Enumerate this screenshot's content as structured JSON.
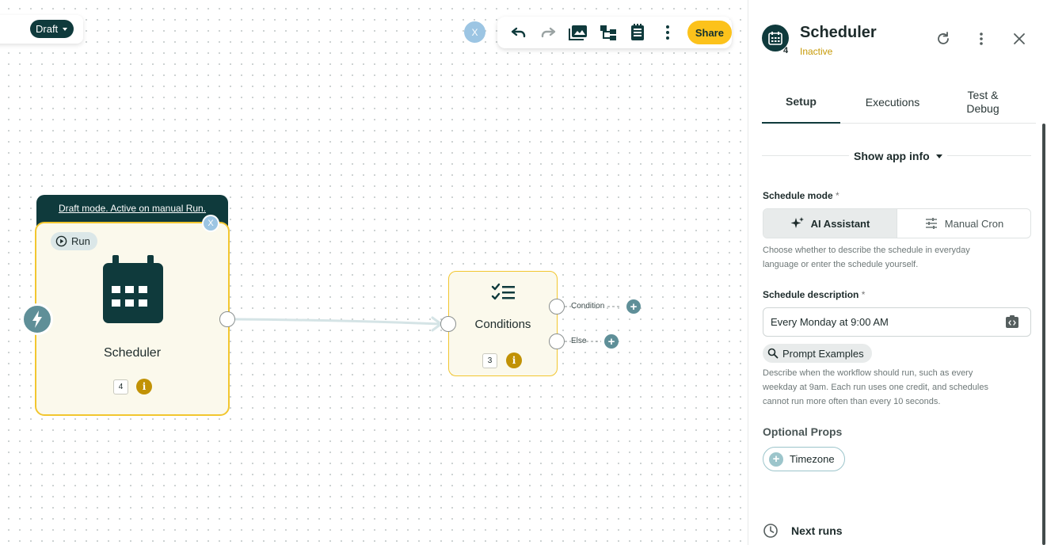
{
  "toolbar": {
    "draft_label": "Draft",
    "close_label": "X",
    "share_label": "Share"
  },
  "canvas": {
    "draft_banner": "Draft mode. Active on manual Run.",
    "scheduler_node": {
      "run_label": "Run",
      "close_label": "X",
      "title": "Scheduler",
      "badge": "4"
    },
    "conditions_node": {
      "title": "Conditions",
      "badge": "3",
      "branches": [
        "Condition",
        "Else"
      ]
    }
  },
  "panel": {
    "title": "Scheduler",
    "status": "Inactive",
    "app_badge": "4",
    "tabs": [
      {
        "label": "Setup",
        "active": true
      },
      {
        "label": "Executions",
        "active": false
      },
      {
        "label": "Test & Debug",
        "active": false
      }
    ],
    "show_app_info": "Show app info",
    "schedule_mode": {
      "label": "Schedule mode",
      "required": "*",
      "options": [
        "AI Assistant",
        "Manual Cron"
      ],
      "selected": "AI Assistant",
      "hint": "Choose whether to describe the schedule in everyday language or enter the schedule yourself."
    },
    "schedule_description": {
      "label": "Schedule description",
      "required": "*",
      "value": "Every Monday at 9:00 AM",
      "prompt_examples": "Prompt Examples",
      "hint": "Describe when the workflow should run, such as every weekday at 9am. Each run uses one credit, and schedules cannot run more often than every 10 seconds."
    },
    "optional_props": {
      "title": "Optional Props",
      "items": [
        "Timezone"
      ]
    },
    "next_runs": "Next runs"
  },
  "colors": {
    "dark_teal": "#0f3a3c",
    "accent_yellow": "#fcc21b",
    "node_border": "#f2c62f",
    "node_bg": "#fbf9ec",
    "inactive": "#c79a06",
    "light_blue": "#9cc5e3"
  }
}
